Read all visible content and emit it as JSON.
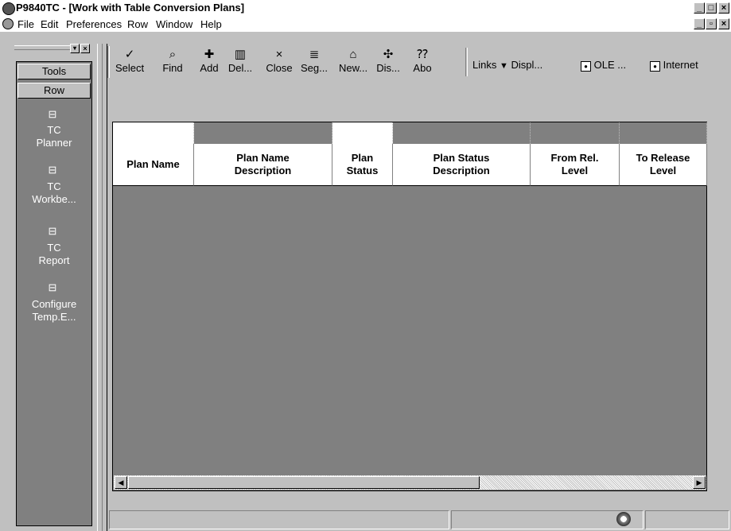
{
  "window": {
    "title": "P9840TC - [Work with Table Conversion Plans]",
    "controls": [
      "_",
      "□",
      "×"
    ],
    "mdi_controls": [
      "_",
      "▫",
      "×"
    ]
  },
  "menu": {
    "items": [
      "File",
      "Edit",
      "Preferences",
      "Row",
      "Window",
      "Help"
    ]
  },
  "tools_pane": {
    "header_tools": "Tools",
    "header_row": "Row",
    "items": [
      {
        "line1": "TC",
        "line2": "Planner"
      },
      {
        "line1": "TC",
        "line2": "Workbe..."
      },
      {
        "line1": "TC",
        "line2": "Report"
      },
      {
        "line1": "Configure",
        "line2": "Temp.E..."
      }
    ]
  },
  "toolbar": {
    "buttons": [
      {
        "label": "Select",
        "icon": "✓"
      },
      {
        "label": "Find",
        "icon": "⌕"
      },
      {
        "label": "Add",
        "icon": "✚"
      },
      {
        "label": "Del...",
        "icon": "▥"
      },
      {
        "label": "Close",
        "icon": "×"
      },
      {
        "label": "Seg...",
        "icon": "≣"
      },
      {
        "label": "New...",
        "icon": "⌂"
      },
      {
        "label": "Dis...",
        "icon": "✣"
      },
      {
        "label": "Abo",
        "icon": "⁇"
      }
    ],
    "links_label": "Links",
    "display_label": "Displ...",
    "ole_label": "OLE ...",
    "internet_label": "Internet"
  },
  "grid": {
    "columns": [
      {
        "label_line1": "Plan Name",
        "label_line2": ""
      },
      {
        "label_line1": "Plan Name",
        "label_line2": "Description"
      },
      {
        "label_line1": "Plan",
        "label_line2": "Status"
      },
      {
        "label_line1": "Plan Status",
        "label_line2": "Description"
      },
      {
        "label_line1": "From Rel.",
        "label_line2": "Level"
      },
      {
        "label_line1": "To Release",
        "label_line2": "Level"
      }
    ],
    "rows": []
  }
}
